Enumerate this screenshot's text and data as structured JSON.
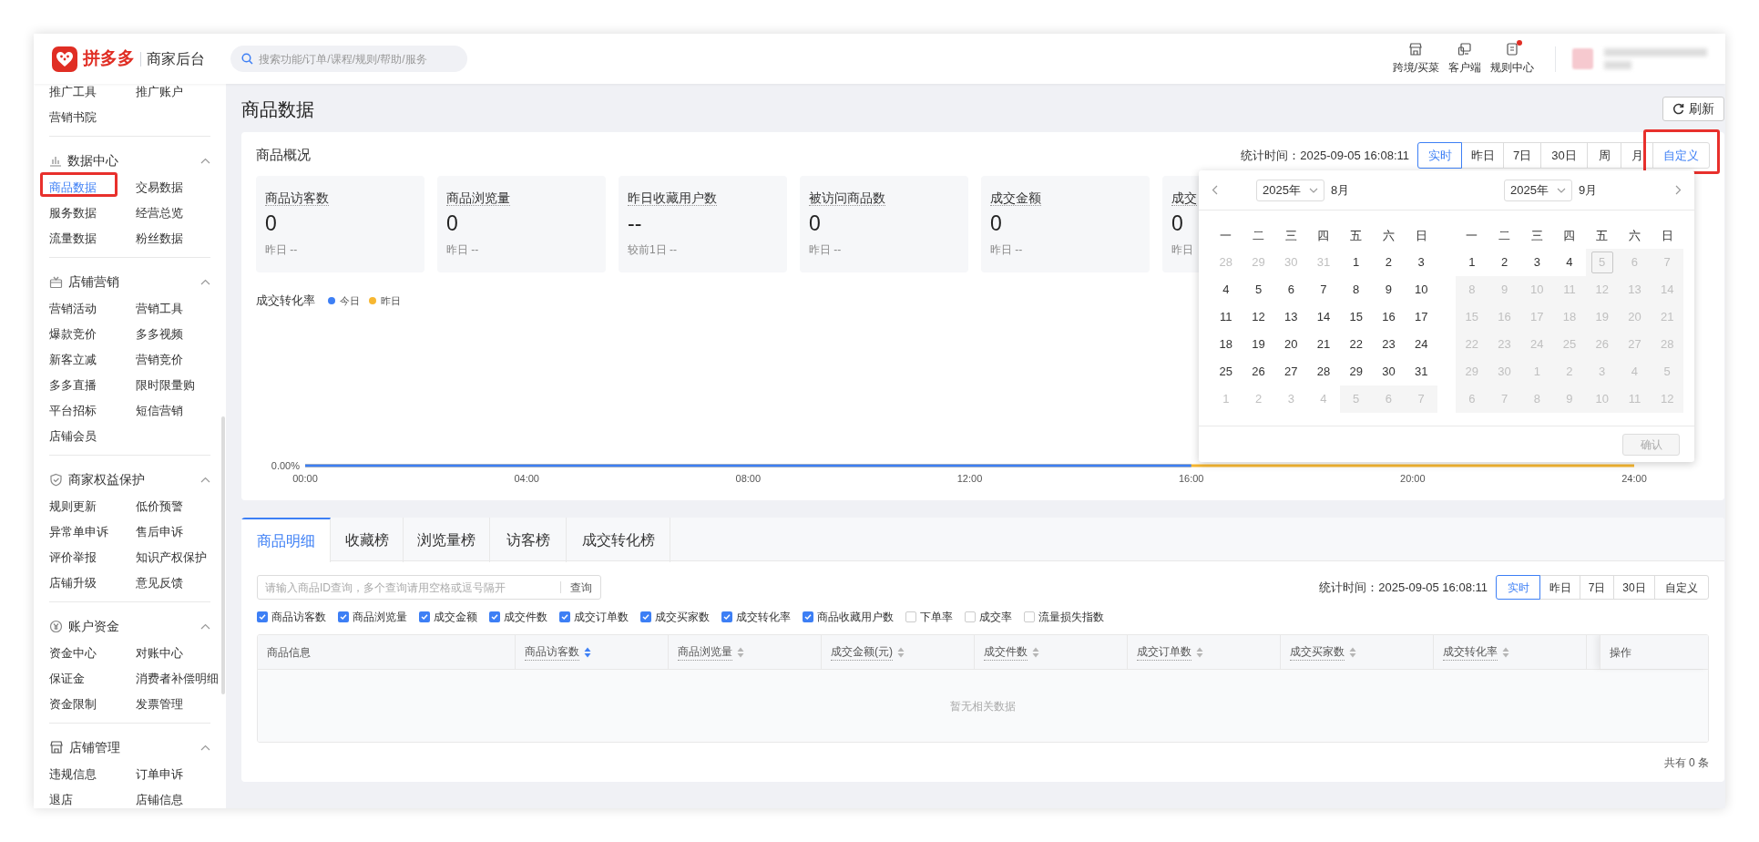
{
  "header": {
    "brand": "拼多多",
    "subtitle": "商家后台",
    "search": {
      "placeholder": "搜索功能/订单/课程/规则/帮助/服务"
    },
    "nav": [
      {
        "kind": "store",
        "label": "跨境/买菜",
        "badge": false
      },
      {
        "kind": "client",
        "label": "客户端",
        "badge": false
      },
      {
        "kind": "rules",
        "label": "规则中心",
        "badge": true
      }
    ]
  },
  "sidebar": {
    "groups": [
      {
        "items": [
          {
            "label": "推广工具",
            "selected": false,
            "highlighted": false
          },
          {
            "label": "推广账户",
            "selected": false,
            "highlighted": false
          },
          {
            "label": "营销书院",
            "selected": false,
            "highlighted": false
          }
        ]
      },
      {
        "title": "数据中心",
        "kind": "chart",
        "expanded": true,
        "items": [
          {
            "label": "商品数据",
            "selected": true,
            "highlighted": true
          },
          {
            "label": "交易数据",
            "selected": false,
            "highlighted": false
          },
          {
            "label": "服务数据",
            "selected": false,
            "highlighted": false
          },
          {
            "label": "经营总览",
            "selected": false,
            "highlighted": false
          },
          {
            "label": "流量数据",
            "selected": false,
            "highlighted": false
          },
          {
            "label": "粉丝数据",
            "selected": false,
            "highlighted": false
          }
        ]
      },
      {
        "title": "店铺营销",
        "kind": "gift",
        "expanded": true,
        "items": [
          {
            "label": "营销活动",
            "selected": false,
            "highlighted": false
          },
          {
            "label": "营销工具",
            "selected": false,
            "highlighted": false
          },
          {
            "label": "爆款竞价",
            "selected": false,
            "highlighted": false
          },
          {
            "label": "多多视频",
            "selected": false,
            "highlighted": false
          },
          {
            "label": "新客立减",
            "selected": false,
            "highlighted": false
          },
          {
            "label": "营销竞价",
            "selected": false,
            "highlighted": false
          },
          {
            "label": "多多直播",
            "selected": false,
            "highlighted": false
          },
          {
            "label": "限时限量购",
            "selected": false,
            "highlighted": false
          },
          {
            "label": "平台招标",
            "selected": false,
            "highlighted": false
          },
          {
            "label": "短信营销",
            "selected": false,
            "highlighted": false
          },
          {
            "label": "店铺会员",
            "selected": false,
            "highlighted": false
          }
        ]
      },
      {
        "title": "商家权益保护",
        "kind": "shield",
        "expanded": true,
        "items": [
          {
            "label": "规则更新",
            "selected": false,
            "highlighted": false
          },
          {
            "label": "低价预警",
            "selected": false,
            "highlighted": false
          },
          {
            "label": "异常单申诉",
            "selected": false,
            "highlighted": false
          },
          {
            "label": "售后申诉",
            "selected": false,
            "highlighted": false
          },
          {
            "label": "评价举报",
            "selected": false,
            "highlighted": false
          },
          {
            "label": "知识产权保护",
            "selected": false,
            "highlighted": false
          },
          {
            "label": "店铺升级",
            "selected": false,
            "highlighted": false
          },
          {
            "label": "意见反馈",
            "selected": false,
            "highlighted": false
          }
        ]
      },
      {
        "title": "账户资金",
        "kind": "yen",
        "expanded": true,
        "items": [
          {
            "label": "资金中心",
            "selected": false,
            "highlighted": false
          },
          {
            "label": "对账中心",
            "selected": false,
            "highlighted": false
          },
          {
            "label": "保证金",
            "selected": false,
            "highlighted": false
          },
          {
            "label": "消费者补偿明细",
            "selected": false,
            "highlighted": false
          },
          {
            "label": "资金限制",
            "selected": false,
            "highlighted": false
          },
          {
            "label": "发票管理",
            "selected": false,
            "highlighted": false
          }
        ]
      },
      {
        "title": "店铺管理",
        "kind": "store",
        "expanded": true,
        "items": [
          {
            "label": "违规信息",
            "selected": false,
            "highlighted": false
          },
          {
            "label": "订单申诉",
            "selected": false,
            "highlighted": false
          },
          {
            "label": "退店",
            "selected": false,
            "highlighted": false
          },
          {
            "label": "店铺信息",
            "selected": false,
            "highlighted": false
          }
        ]
      }
    ]
  },
  "page": {
    "title": "商品数据",
    "refresh_button": "刷新"
  },
  "overview": {
    "title": "商品概况",
    "stat_time": "统计时间：2025-09-05 16:08:11",
    "ranges": [
      {
        "label": "实时",
        "selected": true,
        "open": false,
        "highlighted": false
      },
      {
        "label": "昨日",
        "selected": false,
        "open": false,
        "highlighted": false
      },
      {
        "label": "7日",
        "selected": false,
        "open": false,
        "highlighted": false
      },
      {
        "label": "30日",
        "selected": false,
        "open": false,
        "highlighted": false
      },
      {
        "label": "周",
        "selected": false,
        "open": false,
        "highlighted": false
      },
      {
        "label": "月",
        "selected": false,
        "open": false,
        "highlighted": false
      },
      {
        "label": "自定义",
        "selected": false,
        "open": true,
        "highlighted": true
      }
    ],
    "metrics": [
      {
        "label": "商品访客数",
        "value": "0",
        "compare": "昨日 --"
      },
      {
        "label": "商品浏览量",
        "value": "0",
        "compare": "昨日 --"
      },
      {
        "label": "昨日收藏用户数",
        "value": "--",
        "compare": "较前1日 --"
      },
      {
        "label": "被访问商品数",
        "value": "0",
        "compare": "昨日 --"
      },
      {
        "label": "成交金额",
        "value": "0",
        "compare": "昨日 --"
      },
      {
        "label": "成交",
        "value": "0",
        "compare": "昨日"
      }
    ],
    "chart_title": "成交转化率",
    "chart": {
      "y_label": "0.00%",
      "x_labels": [
        "00:00",
        "04:00",
        "08:00",
        "12:00",
        "16:00",
        "20:00",
        "24:00"
      ],
      "legend": [
        {
          "name": "今日",
          "color": "#3d7ff5"
        },
        {
          "name": "昨日",
          "color": "#f7b731"
        }
      ]
    },
    "date_picker": {
      "months": [
        {
          "year": "2025年",
          "month": "8月",
          "weekdays": [
            "一",
            "二",
            "三",
            "四",
            "五",
            "六",
            "日"
          ],
          "weeks": [
            [
              {
                "d": "28",
                "kind": "outside"
              },
              {
                "d": "29",
                "kind": "outside"
              },
              {
                "d": "30",
                "kind": "outside"
              },
              {
                "d": "31",
                "kind": "outside"
              },
              {
                "d": "1",
                "kind": "normal"
              },
              {
                "d": "2",
                "kind": "normal"
              },
              {
                "d": "3",
                "kind": "normal"
              }
            ],
            [
              {
                "d": "4",
                "kind": "normal"
              },
              {
                "d": "5",
                "kind": "normal"
              },
              {
                "d": "6",
                "kind": "normal"
              },
              {
                "d": "7",
                "kind": "normal"
              },
              {
                "d": "8",
                "kind": "normal"
              },
              {
                "d": "9",
                "kind": "normal"
              },
              {
                "d": "10",
                "kind": "normal"
              }
            ],
            [
              {
                "d": "11",
                "kind": "normal"
              },
              {
                "d": "12",
                "kind": "normal"
              },
              {
                "d": "13",
                "kind": "normal"
              },
              {
                "d": "14",
                "kind": "normal"
              },
              {
                "d": "15",
                "kind": "normal"
              },
              {
                "d": "16",
                "kind": "normal"
              },
              {
                "d": "17",
                "kind": "normal"
              }
            ],
            [
              {
                "d": "18",
                "kind": "normal"
              },
              {
                "d": "19",
                "kind": "normal"
              },
              {
                "d": "20",
                "kind": "normal"
              },
              {
                "d": "21",
                "kind": "normal"
              },
              {
                "d": "22",
                "kind": "normal"
              },
              {
                "d": "23",
                "kind": "normal"
              },
              {
                "d": "24",
                "kind": "normal"
              }
            ],
            [
              {
                "d": "25",
                "kind": "normal"
              },
              {
                "d": "26",
                "kind": "normal"
              },
              {
                "d": "27",
                "kind": "normal"
              },
              {
                "d": "28",
                "kind": "normal"
              },
              {
                "d": "29",
                "kind": "normal"
              },
              {
                "d": "30",
                "kind": "normal"
              },
              {
                "d": "31",
                "kind": "normal"
              }
            ],
            [
              {
                "d": "1",
                "kind": "outside"
              },
              {
                "d": "2",
                "kind": "outside"
              },
              {
                "d": "3",
                "kind": "outside"
              },
              {
                "d": "4",
                "kind": "outside"
              },
              {
                "d": "5",
                "kind": "disabled"
              },
              {
                "d": "6",
                "kind": "disabled"
              },
              {
                "d": "7",
                "kind": "disabled"
              }
            ]
          ]
        },
        {
          "year": "2025年",
          "month": "9月",
          "weekdays": [
            "一",
            "二",
            "三",
            "四",
            "五",
            "六",
            "日"
          ],
          "weeks": [
            [
              {
                "d": "1",
                "kind": "normal"
              },
              {
                "d": "2",
                "kind": "normal"
              },
              {
                "d": "3",
                "kind": "normal"
              },
              {
                "d": "4",
                "kind": "normal"
              },
              {
                "d": "5",
                "kind": "today"
              },
              {
                "d": "6",
                "kind": "disabled"
              },
              {
                "d": "7",
                "kind": "disabled"
              }
            ],
            [
              {
                "d": "8",
                "kind": "disabled"
              },
              {
                "d": "9",
                "kind": "disabled"
              },
              {
                "d": "10",
                "kind": "disabled"
              },
              {
                "d": "11",
                "kind": "disabled"
              },
              {
                "d": "12",
                "kind": "disabled"
              },
              {
                "d": "13",
                "kind": "disabled"
              },
              {
                "d": "14",
                "kind": "disabled"
              }
            ],
            [
              {
                "d": "15",
                "kind": "disabled"
              },
              {
                "d": "16",
                "kind": "disabled"
              },
              {
                "d": "17",
                "kind": "disabled"
              },
              {
                "d": "18",
                "kind": "disabled"
              },
              {
                "d": "19",
                "kind": "disabled"
              },
              {
                "d": "20",
                "kind": "disabled"
              },
              {
                "d": "21",
                "kind": "disabled"
              }
            ],
            [
              {
                "d": "22",
                "kind": "disabled"
              },
              {
                "d": "23",
                "kind": "disabled"
              },
              {
                "d": "24",
                "kind": "disabled"
              },
              {
                "d": "25",
                "kind": "disabled"
              },
              {
                "d": "26",
                "kind": "disabled"
              },
              {
                "d": "27",
                "kind": "disabled"
              },
              {
                "d": "28",
                "kind": "disabled"
              }
            ],
            [
              {
                "d": "29",
                "kind": "disabled"
              },
              {
                "d": "30",
                "kind": "disabled"
              },
              {
                "d": "1",
                "kind": "disabled"
              },
              {
                "d": "2",
                "kind": "disabled"
              },
              {
                "d": "3",
                "kind": "disabled"
              },
              {
                "d": "4",
                "kind": "disabled"
              },
              {
                "d": "5",
                "kind": "disabled"
              }
            ],
            [
              {
                "d": "6",
                "kind": "disabled"
              },
              {
                "d": "7",
                "kind": "disabled"
              },
              {
                "d": "8",
                "kind": "disabled"
              },
              {
                "d": "9",
                "kind": "disabled"
              },
              {
                "d": "10",
                "kind": "disabled"
              },
              {
                "d": "11",
                "kind": "disabled"
              },
              {
                "d": "12",
                "kind": "disabled"
              }
            ]
          ]
        }
      ],
      "confirm": {
        "label": "确认",
        "disabled": true
      }
    }
  },
  "detail": {
    "tabs": [
      {
        "label": "商品明细",
        "selected": true
      },
      {
        "label": "收藏榜",
        "selected": false
      },
      {
        "label": "浏览量榜",
        "selected": false
      },
      {
        "label": "访客榜",
        "selected": false
      },
      {
        "label": "成交转化榜",
        "selected": false
      }
    ],
    "search": {
      "placeholder": "请输入商品ID查询，多个查询请用空格或逗号隔开",
      "button": "查询"
    },
    "stat_time": "统计时间：2025-09-05 16:08:11",
    "ranges": [
      {
        "label": "实时",
        "selected": true
      },
      {
        "label": "昨日",
        "selected": false
      },
      {
        "label": "7日",
        "selected": false
      },
      {
        "label": "30日",
        "selected": false
      },
      {
        "label": "自定义",
        "selected": false
      }
    ],
    "filters": [
      {
        "label": "商品访客数",
        "checked": true
      },
      {
        "label": "商品浏览量",
        "checked": true
      },
      {
        "label": "成交金额",
        "checked": true
      },
      {
        "label": "成交件数",
        "checked": true
      },
      {
        "label": "成交订单数",
        "checked": true
      },
      {
        "label": "成交买家数",
        "checked": true
      },
      {
        "label": "成交转化率",
        "checked": true
      },
      {
        "label": "商品收藏用户数",
        "checked": true
      },
      {
        "label": "下单率",
        "checked": false
      },
      {
        "label": "成交率",
        "checked": false
      },
      {
        "label": "流量损失指数",
        "checked": false
      }
    ],
    "table": {
      "columns": [
        {
          "label": "商品信息",
          "sortable": false
        },
        {
          "label": "商品访客数",
          "sortable": true,
          "sorted": true
        },
        {
          "label": "商品浏览量",
          "sortable": true,
          "sorted": false
        },
        {
          "label": "成交金额(元)",
          "sortable": true,
          "sorted": false
        },
        {
          "label": "成交件数",
          "sortable": true,
          "sorted": false
        },
        {
          "label": "成交订单数",
          "sortable": true,
          "sorted": false
        },
        {
          "label": "成交买家数",
          "sortable": true,
          "sorted": false
        },
        {
          "label": "成交转化率",
          "sortable": true,
          "sorted": false
        }
      ],
      "action_column": "操作",
      "empty_text": "暂无相关数据"
    },
    "total": "共有 0 条"
  }
}
